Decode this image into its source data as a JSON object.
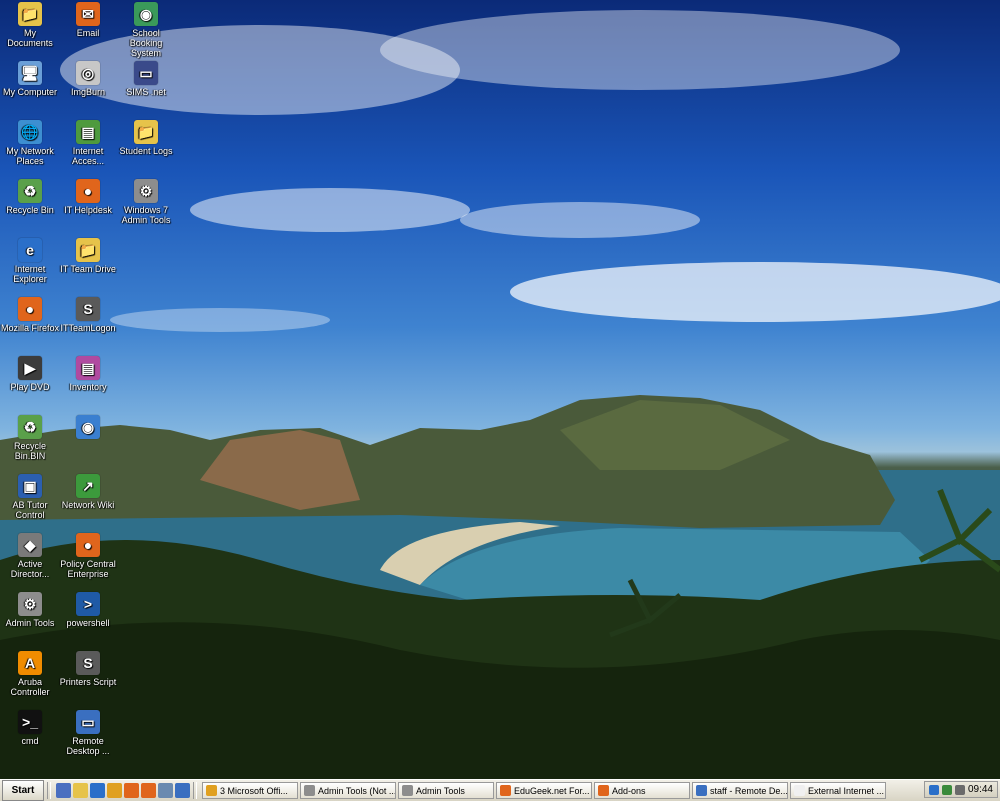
{
  "desktop_icons": [
    {
      "label": "My Documents",
      "name": "my-documents-icon",
      "glyph": "📁",
      "color": "#e6c34a"
    },
    {
      "label": "My Computer",
      "name": "my-computer-icon",
      "glyph": "🖥",
      "color": "#6a9fd8"
    },
    {
      "label": "My Network Places",
      "name": "network-places-icon",
      "glyph": "🌐",
      "color": "#3d8fd1"
    },
    {
      "label": "Recycle Bin",
      "name": "recycle-bin-icon",
      "glyph": "♻",
      "color": "#5aa04a"
    },
    {
      "label": "Internet Explorer",
      "name": "internet-explorer-icon",
      "glyph": "e",
      "color": "#2a6fc9"
    },
    {
      "label": "Mozilla Firefox",
      "name": "firefox-icon",
      "glyph": "●",
      "color": "#e0651c"
    },
    {
      "label": "Play DVD",
      "name": "play-dvd-icon",
      "glyph": "▶",
      "color": "#3c3c3c"
    },
    {
      "label": "Recycle Bin.BIN",
      "name": "recycle-bin-bin-icon",
      "glyph": "♻",
      "color": "#5aa04a"
    },
    {
      "label": "AB Tutor Control",
      "name": "ab-tutor-icon",
      "glyph": "▣",
      "color": "#2b5fb0"
    },
    {
      "label": "Active Director...",
      "name": "active-directory-icon",
      "glyph": "◆",
      "color": "#7a7a7a"
    },
    {
      "label": "Admin Tools",
      "name": "admin-tools-icon",
      "glyph": "⚙",
      "color": "#8d8d8d"
    },
    {
      "label": "Aruba Controller",
      "name": "aruba-controller-icon",
      "glyph": "A",
      "color": "#f08c00"
    },
    {
      "label": "cmd",
      "name": "cmd-icon",
      "glyph": ">_",
      "color": "#111111"
    },
    {
      "label": "Email",
      "name": "email-icon",
      "glyph": "✉",
      "color": "#e0651c"
    },
    {
      "label": "ImgBurn",
      "name": "imgburn-icon",
      "glyph": "◎",
      "color": "#c7c7c7"
    },
    {
      "label": "Internet Acces...",
      "name": "internet-access-icon",
      "glyph": "▤",
      "color": "#4e9a3e"
    },
    {
      "label": "IT Helpdesk",
      "name": "it-helpdesk-icon",
      "glyph": "●",
      "color": "#e0651c"
    },
    {
      "label": "IT Team Drive",
      "name": "it-team-drive-icon",
      "glyph": "📁",
      "color": "#e6c34a"
    },
    {
      "label": "ITTeamLogon",
      "name": "itteamlogon-icon",
      "glyph": "S",
      "color": "#5a5a5a"
    },
    {
      "label": "Inventory",
      "name": "inventory-icon",
      "glyph": "▤",
      "color": "#b04aa0"
    },
    {
      "label": "",
      "name": "redacted-shortcut-icon",
      "glyph": "◉",
      "color": "#3a7fd0"
    },
    {
      "label": "Network Wiki",
      "name": "network-wiki-icon",
      "glyph": "↗",
      "color": "#3c9a3c"
    },
    {
      "label": "Policy Central Enterprise",
      "name": "policy-central-icon",
      "glyph": "●",
      "color": "#e0651c"
    },
    {
      "label": "powershell",
      "name": "powershell-icon",
      "glyph": ">",
      "color": "#1f5aa6"
    },
    {
      "label": "Printers Script",
      "name": "printers-script-icon",
      "glyph": "S",
      "color": "#5a5a5a"
    },
    {
      "label": "Remote Desktop ...",
      "name": "remote-desktop-icon",
      "glyph": "▭",
      "color": "#3a6fc0"
    },
    {
      "label": "School Booking System",
      "name": "school-booking-icon",
      "glyph": "◉",
      "color": "#3a9a5a"
    },
    {
      "label": "SIMS .net",
      "name": "sims-net-icon",
      "glyph": "▭",
      "color": "#3a4a8a"
    },
    {
      "label": "Student Logs",
      "name": "student-logs-icon",
      "glyph": "📁",
      "color": "#e6c34a"
    },
    {
      "label": "Windows 7 Admin Tools",
      "name": "windows7-admin-tools-icon",
      "glyph": "⚙",
      "color": "#8d8d8d"
    }
  ],
  "taskbar": {
    "start_label": "Start",
    "quick_launch": [
      {
        "name": "ql-show-desktop-icon",
        "color": "#4a6fc0"
      },
      {
        "name": "ql-explorer-icon",
        "color": "#e6c34a"
      },
      {
        "name": "ql-ie-icon",
        "color": "#2a6fc9"
      },
      {
        "name": "ql-outlook-icon",
        "color": "#e0a020"
      },
      {
        "name": "ql-firefox-icon",
        "color": "#e0651c"
      },
      {
        "name": "ql-firefox2-icon",
        "color": "#e0651c"
      },
      {
        "name": "ql-window-icon",
        "color": "#6a8ab0"
      },
      {
        "name": "ql-remote-icon",
        "color": "#3a6fc0"
      }
    ],
    "tasks": [
      {
        "label": "3 Microsoft Offi...",
        "color": "#e0a020",
        "width": 96
      },
      {
        "label": "Admin Tools (Not ...",
        "color": "#8d8d8d",
        "width": 96
      },
      {
        "label": "Admin Tools",
        "color": "#8d8d8d",
        "width": 96
      },
      {
        "label": "EduGeek.net For...",
        "color": "#e0651c",
        "width": 96
      },
      {
        "label": "Add-ons",
        "color": "#e0651c",
        "width": 96
      },
      {
        "label": "staff - Remote De...",
        "color": "#3a6fc0",
        "width": 96
      },
      {
        "label": "External Internet ...",
        "color": "#f0f0f0",
        "width": 96
      }
    ],
    "clock": "09:44"
  }
}
